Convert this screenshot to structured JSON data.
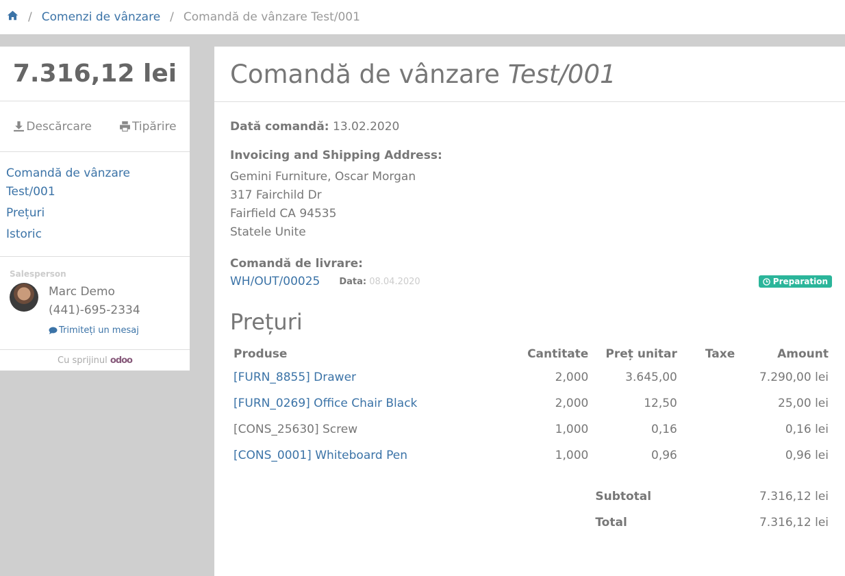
{
  "breadcrumb": {
    "home_icon": "home-icon",
    "link": "Comenzi de vânzare",
    "current": "Comandă de vânzare Test/001"
  },
  "sidebar": {
    "total": "7.316,12 lei",
    "download_label": "Descărcare",
    "print_label": "Tipărire",
    "nav": {
      "item1_line1": "Comandă de vânzare",
      "item1_line2": "Test/001",
      "item2": "Prețuri",
      "item3": "Istoric"
    },
    "salesperson": {
      "label": "Salesperson",
      "name": "Marc Demo",
      "phone": "(441)-695-2334",
      "message": "Trimiteți un mesaj"
    },
    "footer": "Cu sprijinul",
    "footer_logo": "odoo"
  },
  "main": {
    "title_prefix": "Comandă de vânzare",
    "title_ref": "Test/001",
    "order_date_label": "Dată comandă:",
    "order_date": "13.02.2020",
    "address_label": "Invoicing and Shipping Address:",
    "address": [
      "Gemini Furniture, Oscar Morgan",
      "317 Fairchild Dr",
      "Fairfield CA 94535",
      "Statele Unite"
    ],
    "delivery_label": "Comandă de livrare:",
    "delivery_ref": "WH/OUT/00025",
    "delivery_date_label": "Data:",
    "delivery_date": "08.04.2020",
    "delivery_status": "Preparation",
    "prices_title": "Prețuri",
    "table": {
      "headers": [
        "Produse",
        "Cantitate",
        "Preț unitar",
        "Taxe",
        "Amount"
      ],
      "rows": [
        {
          "product": "[FURN_8855] Drawer",
          "qty": "2,000",
          "price": "3.645,00",
          "tax": "",
          "amount": "7.290,00 lei"
        },
        {
          "product": "[FURN_0269] Office Chair Black",
          "qty": "2,000",
          "price": "12,50",
          "tax": "",
          "amount": "25,00 lei"
        },
        {
          "product": "[CONS_25630] Screw",
          "qty": "1,000",
          "price": "0,16",
          "tax": "",
          "amount": "0,16 lei"
        },
        {
          "product": "[CONS_0001] Whiteboard Pen",
          "qty": "1,000",
          "price": "0,96",
          "tax": "",
          "amount": "0,96 lei"
        }
      ],
      "subtotal_label": "Subtotal",
      "subtotal": "7.316,12 lei",
      "total_label": "Total",
      "total": "7.316,12 lei"
    }
  }
}
